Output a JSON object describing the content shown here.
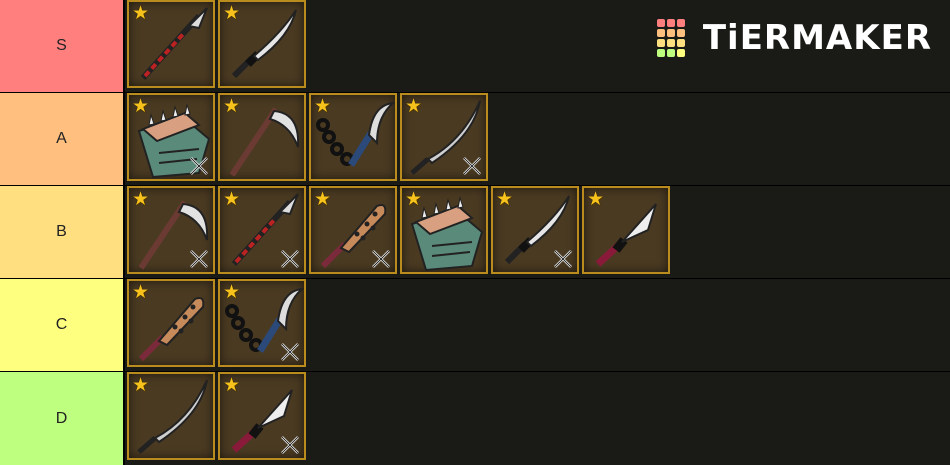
{
  "logo": {
    "text": "TiERMAKER"
  },
  "tiers": [
    {
      "label": "S",
      "color": "#ff7f7f",
      "items": [
        {
          "icon": "spear-icon",
          "starred": true,
          "badge": false
        },
        {
          "icon": "katana-icon",
          "starred": true,
          "badge": false
        }
      ]
    },
    {
      "label": "A",
      "color": "#ffbf7f",
      "items": [
        {
          "icon": "spiked-gauntlet-icon",
          "starred": true,
          "badge": true
        },
        {
          "icon": "scythe-icon",
          "starred": true,
          "badge": false
        },
        {
          "icon": "chain-sickle-icon",
          "starred": true,
          "badge": false
        },
        {
          "icon": "nodachi-icon",
          "starred": true,
          "badge": true
        }
      ]
    },
    {
      "label": "B",
      "color": "#ffdf7f",
      "items": [
        {
          "icon": "scythe-icon",
          "starred": true,
          "badge": true
        },
        {
          "icon": "spear-icon",
          "starred": true,
          "badge": true
        },
        {
          "icon": "spiked-club-icon",
          "starred": true,
          "badge": true
        },
        {
          "icon": "spiked-gauntlet-icon",
          "starred": true,
          "badge": false
        },
        {
          "icon": "katana-icon",
          "starred": true,
          "badge": true
        },
        {
          "icon": "tanto-icon",
          "starred": true,
          "badge": false
        }
      ]
    },
    {
      "label": "C",
      "color": "#ffff7f",
      "items": [
        {
          "icon": "spiked-club-icon",
          "starred": true,
          "badge": false
        },
        {
          "icon": "chain-sickle-icon",
          "starred": true,
          "badge": true
        }
      ]
    },
    {
      "label": "D",
      "color": "#bfff7f",
      "items": [
        {
          "icon": "nodachi-icon",
          "starred": true,
          "badge": false
        },
        {
          "icon": "tanto-icon",
          "starred": true,
          "badge": true
        }
      ]
    }
  ]
}
